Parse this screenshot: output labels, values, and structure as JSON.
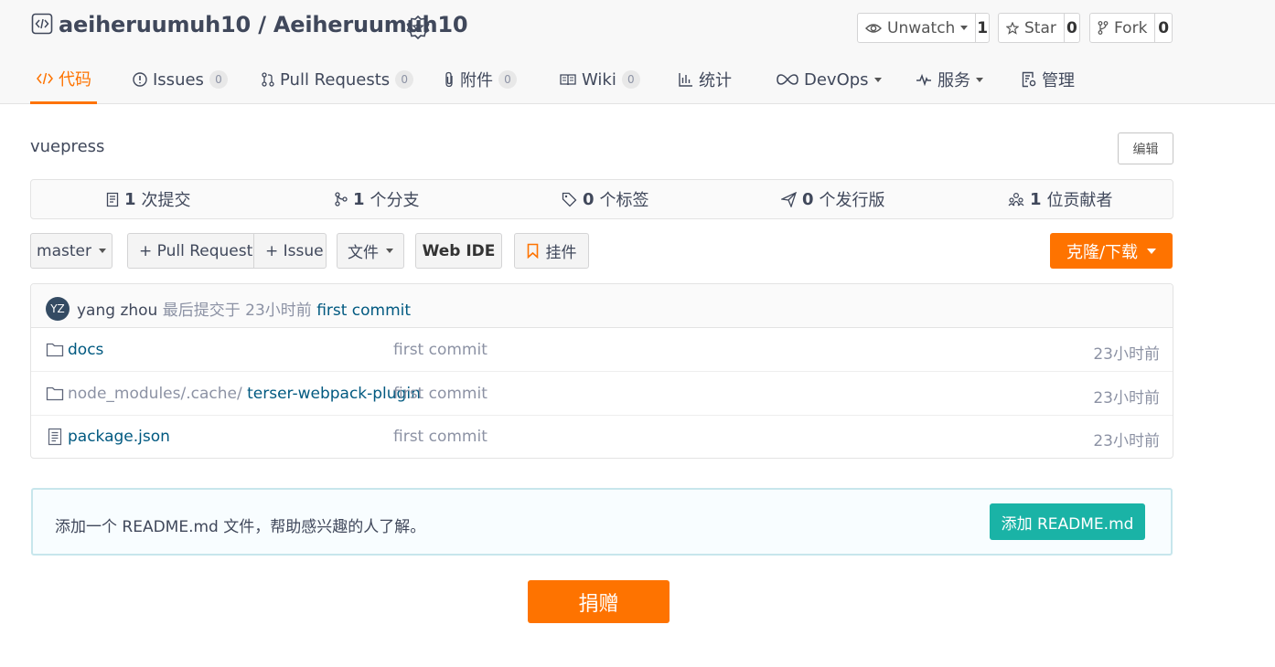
{
  "repo": {
    "title": "aeiheruumuh10 / Aeiheruumuh10",
    "unwatch_label": "Unwatch",
    "watch_count": "1",
    "star_label": "Star",
    "star_count": "0",
    "fork_label": "Fork",
    "fork_count": "0"
  },
  "tabs": [
    {
      "label": "代码",
      "active": true
    },
    {
      "label": "Issues",
      "count": "0"
    },
    {
      "label": "Pull Requests",
      "count": "0"
    },
    {
      "label": "附件",
      "count": "0"
    },
    {
      "label": "Wiki",
      "count": "0"
    },
    {
      "label": "统计"
    },
    {
      "label": "DevOps"
    },
    {
      "label": "服务"
    },
    {
      "label": "管理"
    }
  ],
  "description": "vuepress",
  "edit_label": "编辑",
  "stats": [
    {
      "count": "1",
      "label": "次提交"
    },
    {
      "count": "1",
      "label": "个分支"
    },
    {
      "count": "0",
      "label": "个标签"
    },
    {
      "count": "0",
      "label": "个发行版"
    },
    {
      "count": "1",
      "label": "位贡献者"
    }
  ],
  "toolbar": {
    "branch": "master",
    "pull_request": "+ Pull Request",
    "issue": "+ Issue",
    "files": "文件",
    "web_ide": "Web IDE",
    "widget": "挂件",
    "clone": "克隆/下载"
  },
  "last_commit": {
    "avatar_initials": "YZ",
    "author": "yang zhou",
    "text": "最后提交于",
    "time": "23小时前",
    "message": "first commit"
  },
  "files": [
    {
      "type": "folder",
      "prefix": "",
      "name": "docs",
      "commit": "first commit",
      "time": "23小时前"
    },
    {
      "type": "folder",
      "prefix": "node_modules/.cache/",
      "name": "terser-webpack-plugin",
      "commit": "first commit",
      "time": "23小时前"
    },
    {
      "type": "file",
      "prefix": "",
      "name": "package.json",
      "commit": "first commit",
      "time": "23小时前"
    }
  ],
  "readme": {
    "text": "添加一个 README.md 文件，帮助感兴趣的人了解。",
    "button": "添加 README.md"
  },
  "donate_label": "捐赠",
  "colors": {
    "accent": "#fe7300",
    "teal": "#1ab3a6",
    "link": "#005980"
  }
}
